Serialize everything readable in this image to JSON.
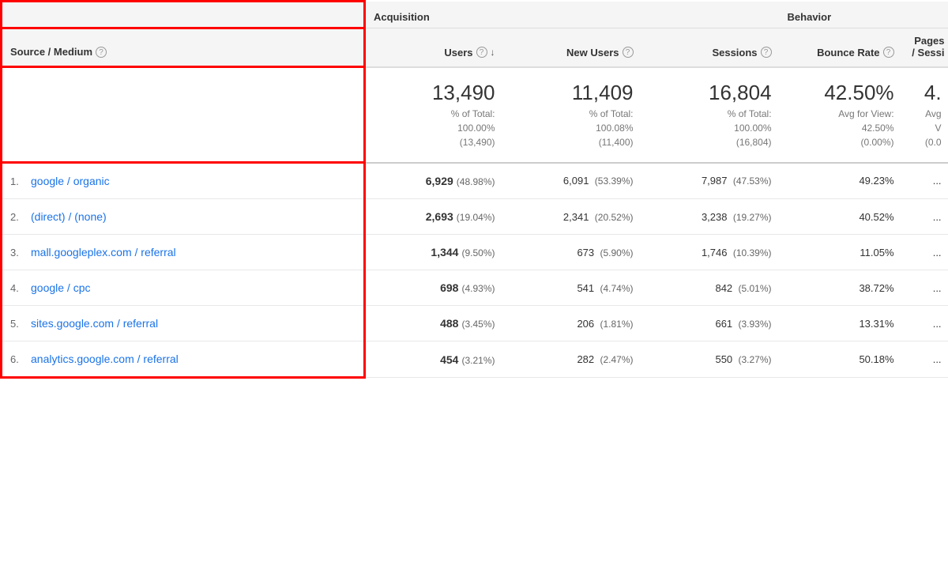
{
  "sections": {
    "acquisition": "Acquisition",
    "behavior": "Behavior"
  },
  "columns": {
    "source_medium": "Source / Medium",
    "users": "Users",
    "new_users": "New Users",
    "sessions": "Sessions",
    "bounce_rate": "Bounce Rate",
    "pages_per_session": "Pages / Sessi"
  },
  "totals": {
    "users": "13,490",
    "users_pct_label": "% of Total:",
    "users_pct": "100.00%",
    "users_total": "(13,490)",
    "new_users": "11,409",
    "new_users_pct_label": "% of Total:",
    "new_users_pct": "100.08%",
    "new_users_total": "(11,400)",
    "sessions": "16,804",
    "sessions_pct_label": "% of Total:",
    "sessions_pct": "100.00%",
    "sessions_total": "(16,804)",
    "bounce_rate": "42.50%",
    "bounce_rate_avg_label": "Avg for View:",
    "bounce_rate_avg": "42.50%",
    "bounce_rate_diff": "(0.00%)",
    "pages_per_session": "4.",
    "pages_avg_label": "Avg",
    "pages_avg": "V",
    "pages_diff": "(0.0"
  },
  "rows": [
    {
      "num": "1.",
      "source": "google / organic",
      "users": "6,929",
      "users_pct": "(48.98%)",
      "new_users": "6,091",
      "new_users_pct": "(53.39%)",
      "sessions": "7,987",
      "sessions_pct": "(47.53%)",
      "bounce_rate": "49.23%"
    },
    {
      "num": "2.",
      "source": "(direct) / (none)",
      "users": "2,693",
      "users_pct": "(19.04%)",
      "new_users": "2,341",
      "new_users_pct": "(20.52%)",
      "sessions": "3,238",
      "sessions_pct": "(19.27%)",
      "bounce_rate": "40.52%"
    },
    {
      "num": "3.",
      "source": "mall.googleplex.com / referral",
      "users": "1,344",
      "users_pct": "(9.50%)",
      "new_users": "673",
      "new_users_pct": "(5.90%)",
      "sessions": "1,746",
      "sessions_pct": "(10.39%)",
      "bounce_rate": "11.05%"
    },
    {
      "num": "4.",
      "source": "google / cpc",
      "users": "698",
      "users_pct": "(4.93%)",
      "new_users": "541",
      "new_users_pct": "(4.74%)",
      "sessions": "842",
      "sessions_pct": "(5.01%)",
      "bounce_rate": "38.72%"
    },
    {
      "num": "5.",
      "source": "sites.google.com / referral",
      "users": "488",
      "users_pct": "(3.45%)",
      "new_users": "206",
      "new_users_pct": "(1.81%)",
      "sessions": "661",
      "sessions_pct": "(3.93%)",
      "bounce_rate": "13.31%"
    },
    {
      "num": "6.",
      "source": "analytics.google.com / referral",
      "users": "454",
      "users_pct": "(3.21%)",
      "new_users": "282",
      "new_users_pct": "(2.47%)",
      "sessions": "550",
      "sessions_pct": "(3.27%)",
      "bounce_rate": "50.18%"
    }
  ]
}
